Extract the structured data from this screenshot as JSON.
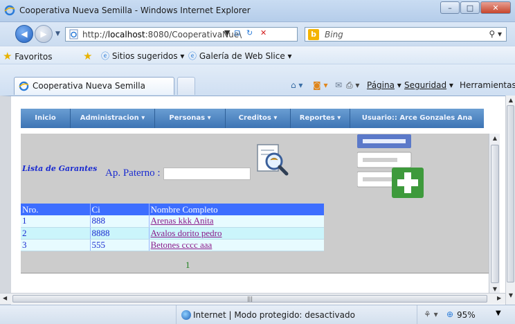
{
  "window": {
    "title": "Cooperativa Nueva Semilla - Windows Internet Explorer",
    "minimize_glyph": "–",
    "maximize_glyph": "□",
    "close_glyph": "✕"
  },
  "address_bar": {
    "url_prefix": "http://",
    "url_host": "localhost",
    "url_rest": ":8080/CooperativaNue\\",
    "search_placeholder": "Bing"
  },
  "favorites_bar": {
    "favorites_label": "Favoritos",
    "suggested_sites": "Sitios sugeridos ▾",
    "web_slice_gallery": "Galería de Web Slice ▾"
  },
  "tab": {
    "label": "Cooperativa Nueva Semilla"
  },
  "command_bar": {
    "page": "Página",
    "security": "Seguridad",
    "tools": "Herramientas"
  },
  "app_menu": {
    "items": [
      "Inicio",
      "Administracion ▾",
      "Personas ▾",
      "Creditos ▾",
      "Reportes ▾",
      "Usuario:: Arce Gonzales Ana"
    ]
  },
  "guarantors": {
    "title": "Lista de Garantes",
    "ap_paterno_label": "Ap. Paterno :",
    "ap_paterno_value": "",
    "columns": [
      "Nro.",
      "Ci",
      "Nombre Completo"
    ],
    "rows": [
      {
        "nro": "1",
        "ci": "888",
        "nombre": "Arenas kkk Anita"
      },
      {
        "nro": "2",
        "ci": "8888",
        "nombre": "Avalos dorito pedro"
      },
      {
        "nro": "3",
        "ci": "555",
        "nombre": "Betones cccc aaa"
      }
    ],
    "page_number": "1"
  },
  "status_bar": {
    "zone_text": "Internet | Modo protegido: desactivado",
    "zoom": "95%"
  },
  "colors": {
    "menu_bar": "#3d74b4",
    "table_header": "#3d6eff",
    "link": "#8a1a8a",
    "label_blue": "#1a2bd0"
  }
}
